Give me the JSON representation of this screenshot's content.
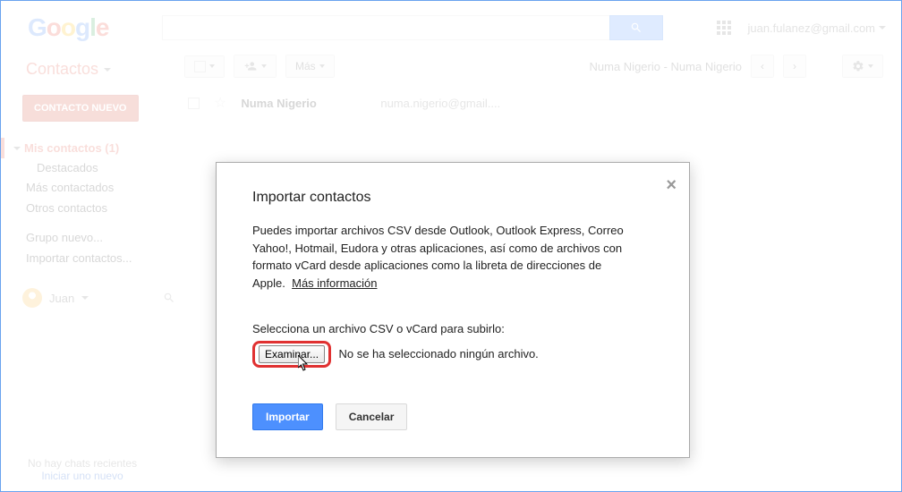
{
  "header": {
    "logo_letters": [
      "G",
      "o",
      "o",
      "g",
      "l",
      "e"
    ],
    "user_email": "juan.fulanez@gmail.com"
  },
  "sidebar": {
    "title": "Contactos",
    "new_contact_label": "CONTACTO NUEVO",
    "items": {
      "my_contacts": "Mis contactos (1)",
      "starred": "Destacados",
      "most_contacted": "Más contactados",
      "other": "Otros contactos",
      "new_group": "Grupo nuevo...",
      "import": "Importar contactos..."
    },
    "profile_name": "Juan"
  },
  "toolbar": {
    "more_label": "Más",
    "page_title": "Numa Nigerio - Numa Nigerio"
  },
  "contact": {
    "name": "Numa Nigerio",
    "email": "numa.nigerio@gmail...."
  },
  "footer": {
    "no_chats": "No hay chats recientes",
    "start_new": "Iniciar uno nuevo"
  },
  "dialog": {
    "title": "Importar contactos",
    "body_text": "Puedes importar archivos CSV desde Outlook, Outlook Express, Correo Yahoo!, Hotmail, Eudora y otras aplicaciones, así como de archivos con formato vCard desde aplicaciones como la libreta de direcciones de Apple.",
    "more_info": "Más información",
    "select_label": "Selecciona un archivo CSV o vCard para subirlo:",
    "browse_label": "Examinar...",
    "no_file": "No se ha seleccionado ningún archivo.",
    "import_label": "Importar",
    "cancel_label": "Cancelar"
  }
}
